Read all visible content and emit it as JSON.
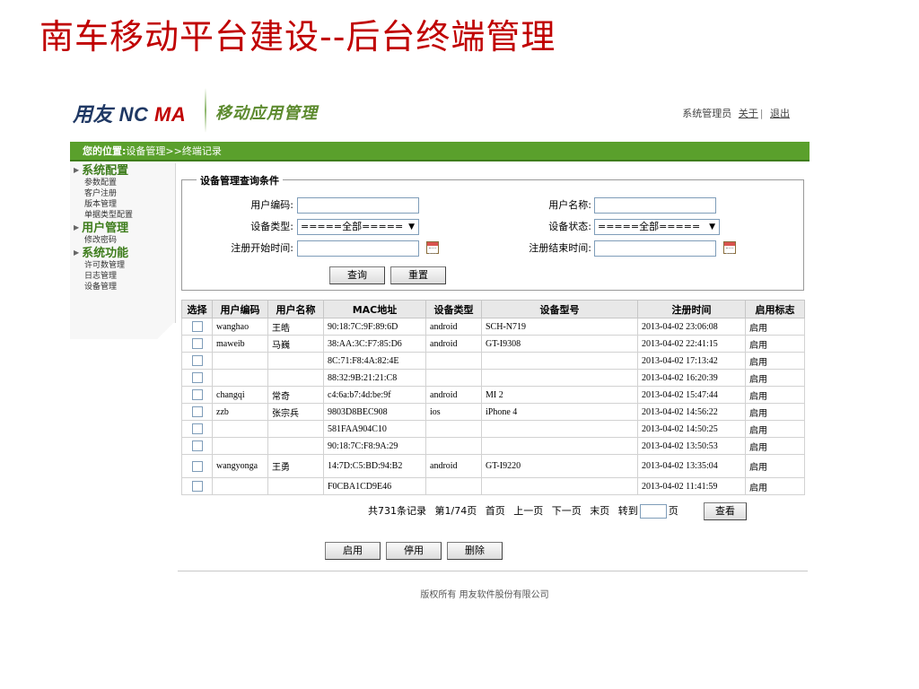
{
  "slide_title": "南车移动平台建设--后台终端管理",
  "header": {
    "brand": "用友 NC ",
    "brand_accent": "MA",
    "app_name": "移动应用管理",
    "user_label": "系统管理员",
    "about_link": "关于",
    "logout_link": "退出"
  },
  "location": {
    "label": "您的位置:",
    "path": "设备管理>>终端记录"
  },
  "sidebar": {
    "groups": [
      {
        "title": "系统配置",
        "items": [
          "参数配置",
          "客户注册",
          "版本管理",
          "单据类型配置"
        ]
      },
      {
        "title": "用户管理",
        "items": [
          "修改密码"
        ]
      },
      {
        "title": "系统功能",
        "items": [
          "许可数管理",
          "日志管理",
          "设备管理"
        ]
      }
    ]
  },
  "query": {
    "legend": "设备管理查询条件",
    "user_code_label": "用户编码:",
    "user_code_value": "",
    "user_name_label": "用户名称:",
    "user_name_value": "",
    "device_type_label": "设备类型:",
    "device_type_value": "=====全部=====",
    "device_status_label": "设备状态:",
    "device_status_value": "=====全部=====",
    "start_time_label": "注册开始时间:",
    "start_time_value": "",
    "end_time_label": "注册结束时间:",
    "end_time_value": "",
    "search_button": "查询",
    "reset_button": "重置"
  },
  "table": {
    "columns": [
      "选择",
      "用户编码",
      "用户名称",
      "MAC地址",
      "设备类型",
      "设备型号",
      "注册时间",
      "启用标志"
    ],
    "rows": [
      {
        "user_code": "wanghao",
        "user_name": "王皓",
        "mac": "90:18:7C:9F:89:6D",
        "device_type": "android",
        "model": "SCH-N719",
        "reg_time": "2013-04-02 23:06:08",
        "flag": "启用"
      },
      {
        "user_code": "maweib",
        "user_name": "马巍",
        "mac": "38:AA:3C:F7:85:D6",
        "device_type": "android",
        "model": "GT-I9308",
        "reg_time": "2013-04-02 22:41:15",
        "flag": "启用"
      },
      {
        "user_code": "",
        "user_name": "",
        "mac": "8C:71:F8:4A:82:4E",
        "device_type": "",
        "model": "",
        "reg_time": "2013-04-02 17:13:42",
        "flag": "启用"
      },
      {
        "user_code": "",
        "user_name": "",
        "mac": "88:32:9B:21:21:C8",
        "device_type": "",
        "model": "",
        "reg_time": "2013-04-02 16:20:39",
        "flag": "启用"
      },
      {
        "user_code": "changqi",
        "user_name": "常奇",
        "mac": "c4:6a:b7:4d:be:9f",
        "device_type": "android",
        "model": "MI 2",
        "reg_time": "2013-04-02 15:47:44",
        "flag": "启用"
      },
      {
        "user_code": "zzb",
        "user_name": "张宗兵",
        "mac": "9803D8BEC908",
        "device_type": "ios",
        "model": "iPhone 4",
        "reg_time": "2013-04-02 14:56:22",
        "flag": "启用"
      },
      {
        "user_code": "",
        "user_name": "",
        "mac": "581FAA904C10",
        "device_type": "",
        "model": "",
        "reg_time": "2013-04-02 14:50:25",
        "flag": "启用"
      },
      {
        "user_code": "",
        "user_name": "",
        "mac": "90:18:7C:F8:9A:29",
        "device_type": "",
        "model": "",
        "reg_time": "2013-04-02 13:50:53",
        "flag": "启用"
      },
      {
        "user_code": "wangyonga",
        "user_name": "王勇",
        "mac": "14:7D:C5:BD:94:B2",
        "device_type": "android",
        "model": "GT-I9220",
        "reg_time": "2013-04-02 13:35:04",
        "flag": "启用"
      },
      {
        "user_code": "",
        "user_name": "",
        "mac": "F0CBA1CD9E46",
        "device_type": "",
        "model": "",
        "reg_time": "2013-04-02 11:41:59",
        "flag": "启用"
      }
    ]
  },
  "pager": {
    "total": "共731条记录",
    "page": "第1/74页",
    "first": "首页",
    "prev": "上一页",
    "next": "下一页",
    "last": "末页",
    "goto_label": "转到",
    "goto_value": "",
    "page_suffix": "页",
    "view_button": "查看"
  },
  "actions": {
    "enable": "启用",
    "disable": "停用",
    "delete": "删除"
  },
  "footer": {
    "copyright": "版权所有 用友软件股份有限公司"
  }
}
